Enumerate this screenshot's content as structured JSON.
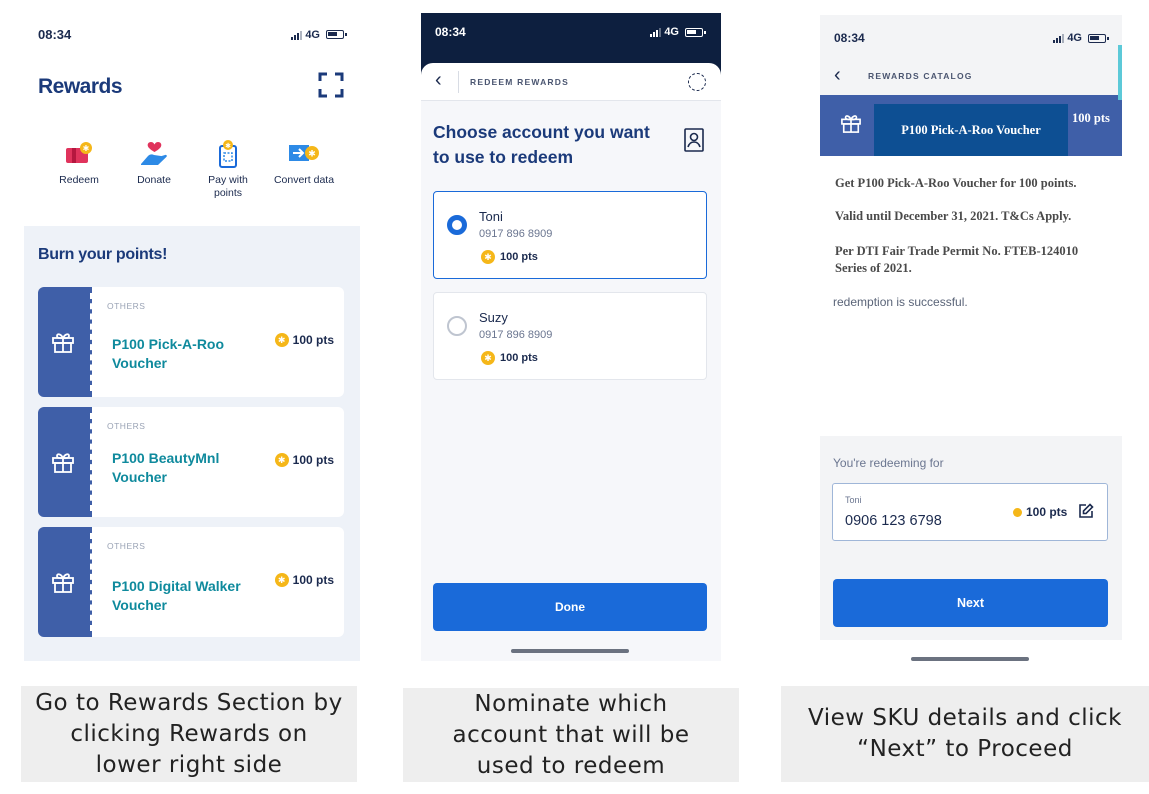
{
  "screen1": {
    "status": {
      "time": "08:34",
      "network": "4G"
    },
    "title": "Rewards",
    "quick_actions": [
      {
        "label": "Redeem",
        "icon": "ticket-icon"
      },
      {
        "label": "Donate",
        "icon": "hand-heart-icon"
      },
      {
        "label": "Pay with points",
        "icon": "phone-coin-icon"
      },
      {
        "label": "Convert data",
        "icon": "convert-data-icon"
      }
    ],
    "section_title": "Burn your points!",
    "vouchers": [
      {
        "category": "OTHERS",
        "name": "P100 Pick-A-Roo Voucher",
        "points": "100 pts"
      },
      {
        "category": "OTHERS",
        "name": "P100 BeautyMnl Voucher",
        "points": "100 pts"
      },
      {
        "category": "OTHERS",
        "name": "P100 Digital Walker Voucher",
        "points": "100 pts"
      }
    ],
    "caption": "Go to Rewards Section by clicking Rewards on lower right side"
  },
  "screen2": {
    "status": {
      "time": "08:34",
      "network": "4G"
    },
    "nav_title": "REDEEM REWARDS",
    "heading": "Choose account you want to use to redeem",
    "accounts": [
      {
        "name": "Toni",
        "number": "0917 896 8909",
        "points": "100 pts",
        "selected": true
      },
      {
        "name": "Suzy",
        "number": "0917 896 8909",
        "points": "100 pts",
        "selected": false
      }
    ],
    "done_label": "Done",
    "caption": "Nominate which account that will be used to redeem"
  },
  "screen3": {
    "status": {
      "time": "08:34",
      "network": "4G"
    },
    "nav_title": "REWARDS CATALOG",
    "voucher_title": "P100 Pick-A-Roo Voucher",
    "voucher_points": "100 pts",
    "details": [
      "Get  P100 Pick-A-Roo Voucher for 100 points.",
      "Valid until December 31, 2021. T&Cs Apply.",
      "Per DTI Fair Trade Permit No. FTEB-124010 Series of 2021."
    ],
    "success_text": "redemption is successful.",
    "redeeming_label": "You're redeeming for",
    "account_name": "Toni",
    "account_number": "0906 123 6798",
    "account_points": "100 pts",
    "next_label": "Next",
    "caption": "View SKU details and click “Next” to Proceed"
  },
  "colors": {
    "navy": "#1b2a4e",
    "primary_blue": "#1a6ad9",
    "ticket_blue": "#3f5fa8",
    "teal": "#0f8a9d",
    "coin": "#f5b719",
    "dark_header": "#0d1f3f"
  }
}
